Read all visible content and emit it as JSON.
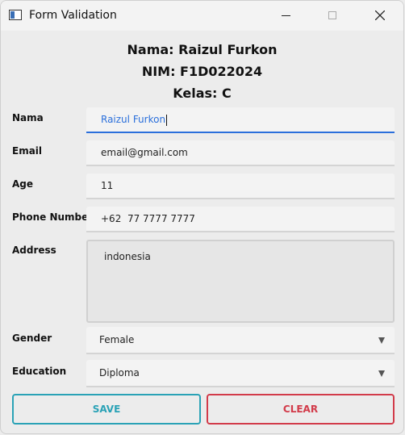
{
  "window": {
    "title": "Form Validation"
  },
  "header": {
    "name_line": "Nama: Raizul Furkon",
    "nim_line": "NIM: F1D022024",
    "class_line": "Kelas: C"
  },
  "form": {
    "nama": {
      "label": "Nama",
      "value": "Raizul Furkon"
    },
    "email": {
      "label": "Email",
      "value": "email@gmail.com"
    },
    "age": {
      "label": "Age",
      "value": "11"
    },
    "phone": {
      "label": "Phone Number",
      "value": "+62  77 7777 7777"
    },
    "address": {
      "label": "Address",
      "value": "indonesia"
    },
    "gender": {
      "label": "Gender",
      "value": "Female"
    },
    "education": {
      "label": "Education",
      "value": "Diploma"
    }
  },
  "buttons": {
    "save": "SAVE",
    "clear": "CLEAR"
  },
  "colors": {
    "focus": "#2a6fdb",
    "save": "#2aa2b6",
    "clear": "#d23b4a"
  }
}
